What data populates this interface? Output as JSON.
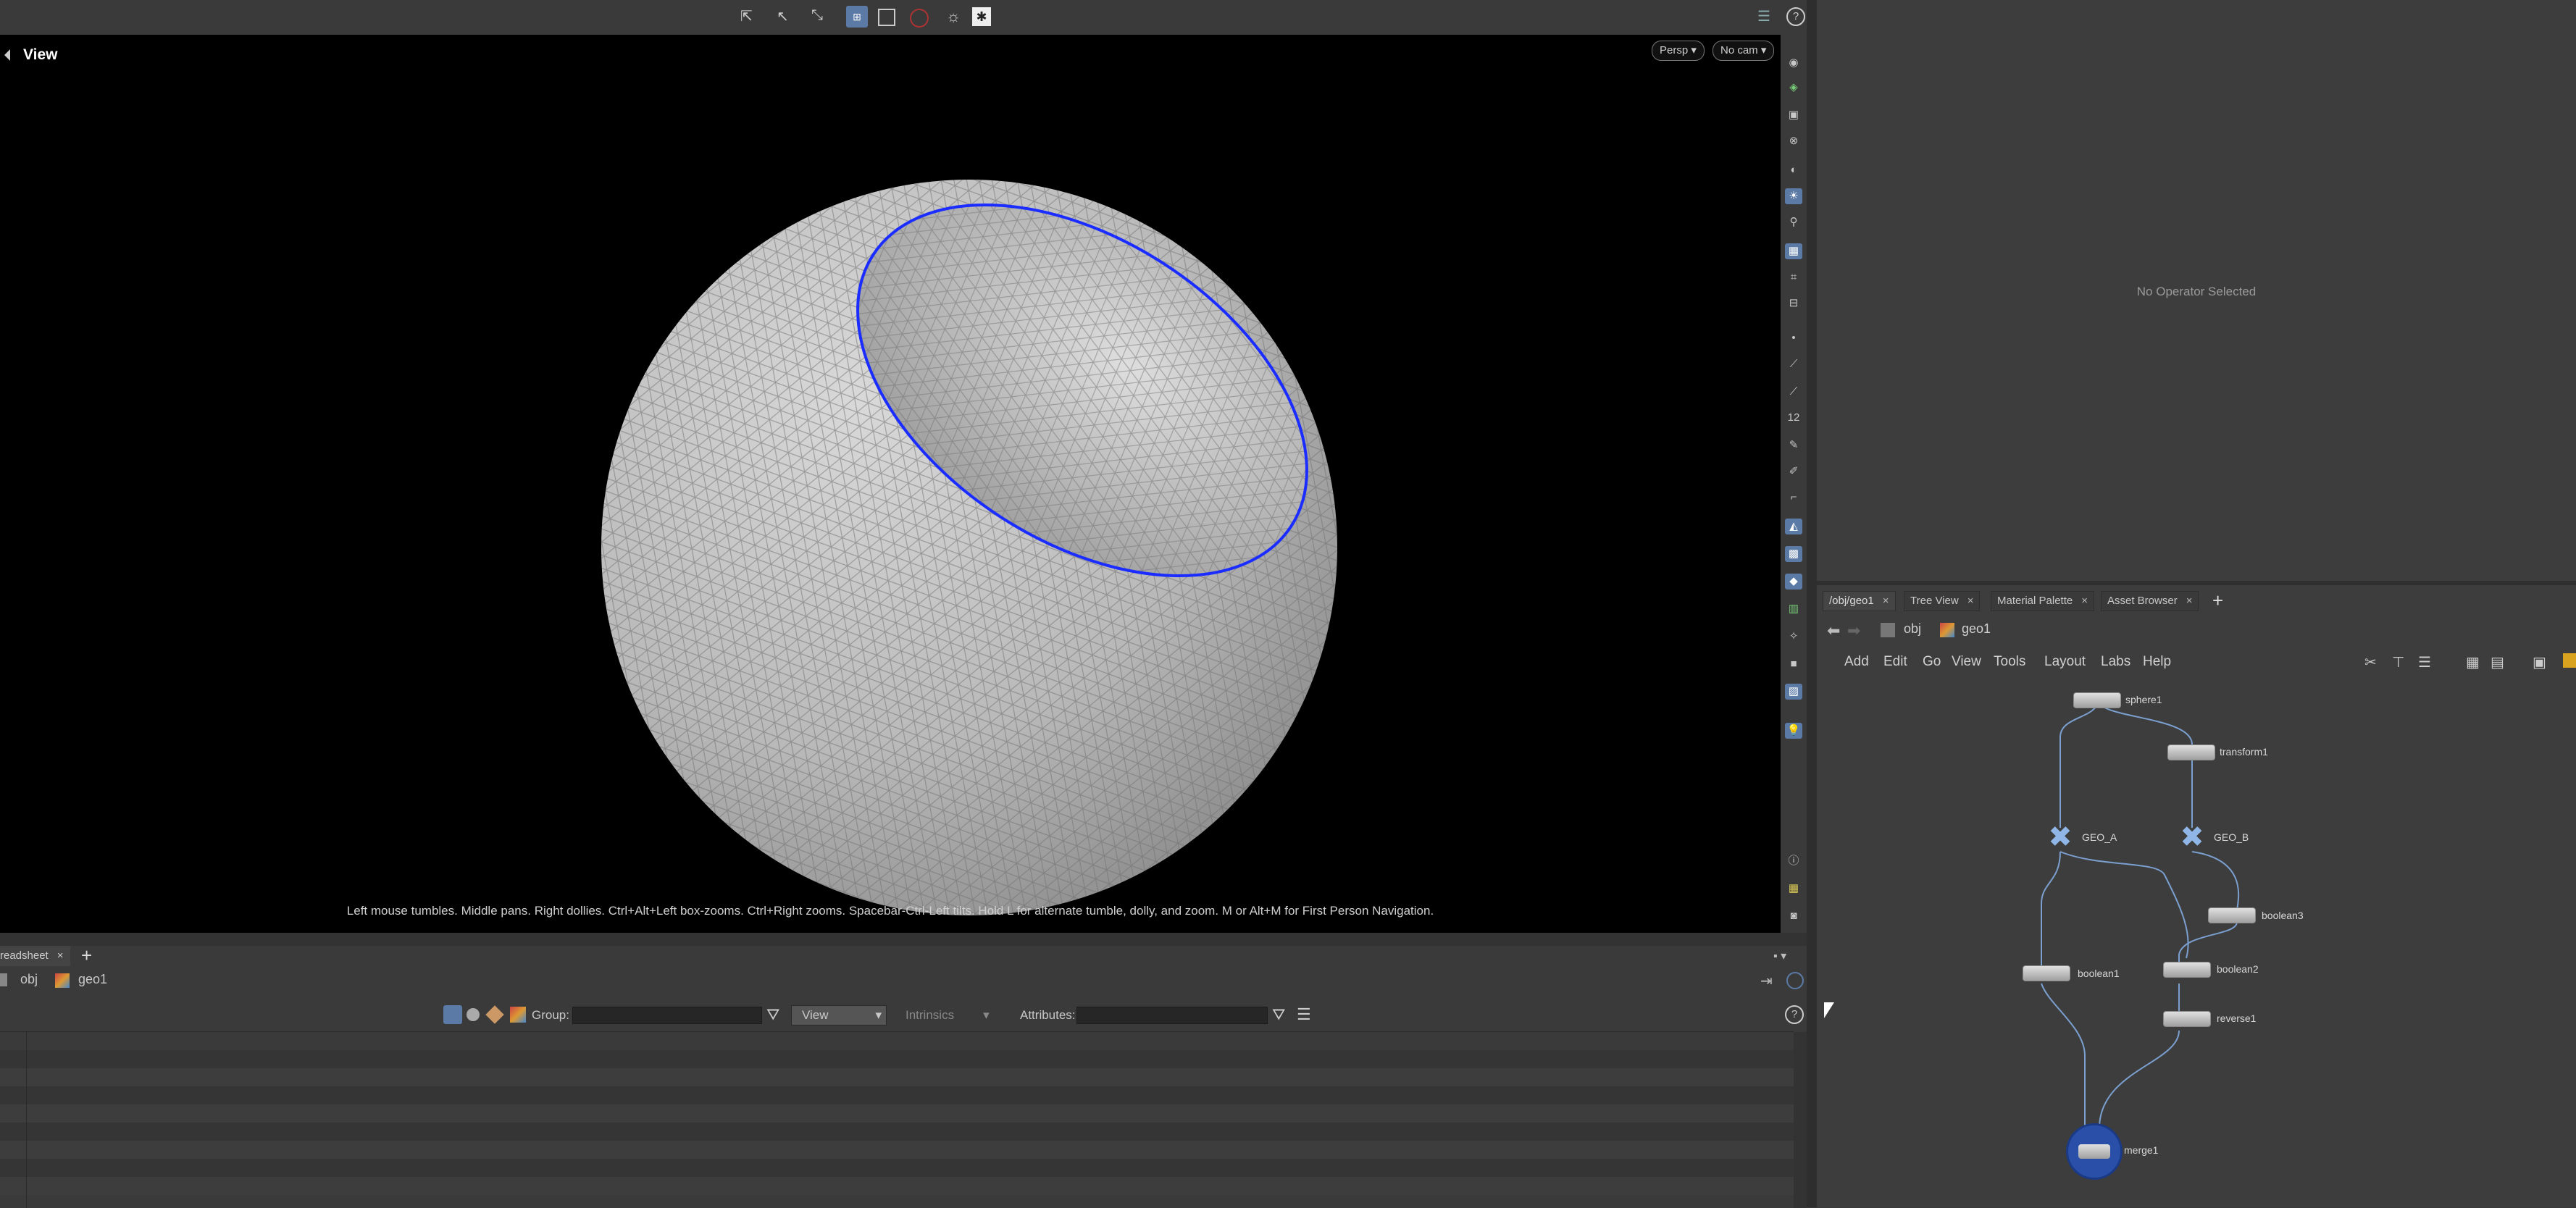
{
  "viewport": {
    "title": "View",
    "persp_label": "Persp",
    "camera_label": "No cam",
    "hint": "Left mouse tumbles. Middle pans. Right dollies. Ctrl+Alt+Left box-zooms. Ctrl+Right zooms. Spacebar-Ctrl-Left tilts. Hold L for alternate tumble, dolly, and zoom. M or Alt+M for First Person Navigation."
  },
  "parameters": {
    "empty_message": "No Operator Selected"
  },
  "network": {
    "tabs": [
      {
        "label": "/obj/geo1"
      },
      {
        "label": "Tree View"
      },
      {
        "label": "Material Palette"
      },
      {
        "label": "Asset Browser"
      }
    ],
    "path": {
      "root": "obj",
      "current": "geo1"
    },
    "menus": [
      "Add",
      "Edit",
      "Go",
      "View",
      "Tools",
      "Layout",
      "Labs",
      "Help"
    ],
    "nodes": {
      "sphere1": "sphere1",
      "transform1": "transform1",
      "geo_a": "GEO_A",
      "geo_b": "GEO_B",
      "boolean3": "boolean3",
      "boolean2": "boolean2",
      "boolean1": "boolean1",
      "reverse1": "reverse1",
      "merge1": "merge1"
    }
  },
  "spreadsheet": {
    "tab_label": "readsheet",
    "path": {
      "root": "obj",
      "current": "geo1"
    },
    "group_label": "Group:",
    "view_value": "View",
    "intrinsics_label": "Intrinsics",
    "attributes_label": "Attributes:"
  },
  "colors": {
    "accent_blue": "#5b7aa5",
    "edge_highlight": "#1a2cff",
    "viewport_bg": "#000000",
    "panel_bg": "#3d3d3d"
  }
}
